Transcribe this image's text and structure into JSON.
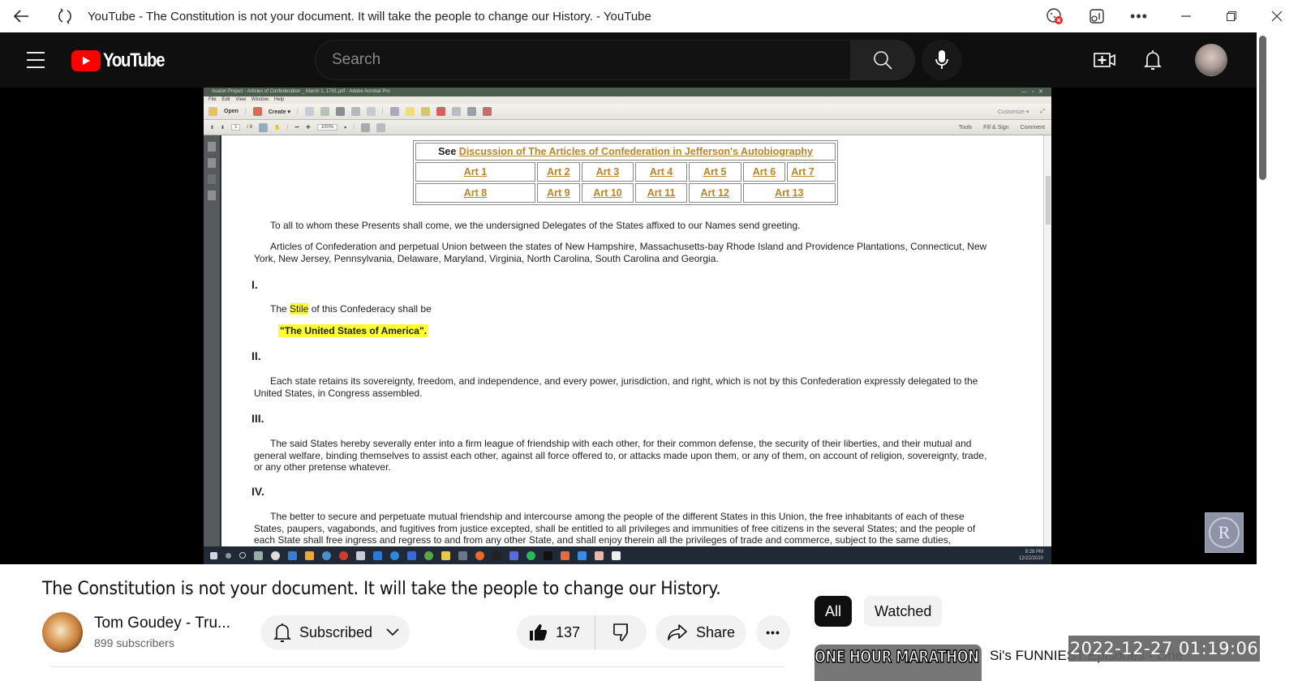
{
  "browser": {
    "tab_title": "YouTube - The Constitution is not your document. It will take the people to change our History. - YouTube",
    "icons": [
      "back-icon",
      "refresh-icon",
      "tracking-prevention-icon",
      "read-aloud-icon",
      "more-icon",
      "minimize-icon",
      "restore-icon",
      "close-icon"
    ]
  },
  "header": {
    "logo_text": "YouTube",
    "search_placeholder": "Search",
    "search_value": ""
  },
  "acrobat": {
    "window_title": "Avalon Project - Articles of Confederation _ March 1, 1781.pdf - Adobe Acrobat Pro",
    "menu": "File  Edit  View  Window  Help",
    "open_label": "Open",
    "create_label": "Create ▾",
    "customize_label": "Customize ▾",
    "page_num": "1",
    "page_total": "/ 8",
    "zoom": "100%",
    "right_tabs": [
      "Tools",
      "Fill & Sign",
      "Comment"
    ],
    "tray_time": "9:28 PM",
    "tray_date": "12/22/2020"
  },
  "document": {
    "see_label": "See",
    "discussion_link": "Discussion of The Articles of Confederation in Jefferson's Autobiography",
    "articles_row1": [
      "Art 1",
      "Art 2",
      "Art 3",
      "Art 4",
      "Art 5",
      "Art 6",
      "Art 7"
    ],
    "articles_row2": [
      "Art 8",
      "Art 9",
      "Art 10",
      "Art 11",
      "Art 12",
      "Art 13"
    ],
    "preamble": "To all to whom these Presents shall come, we the undersigned Delegates of the States affixed to our Names send greeting.",
    "intro": "Articles of Confederation and perpetual Union between the states of New Hampshire, Massachusetts-bay Rhode Island and Providence Plantations, Connecticut, New York, New Jersey, Pennsylvania, Delaware, Maryland, Virginia, North Carolina, South Carolina and Georgia.",
    "sections": [
      {
        "numeral": "I.",
        "text_before": "The ",
        "highlight": "Stile",
        "text_after": " of this Confederacy shall be",
        "quote": "\"The United States of America\"."
      },
      {
        "numeral": "II.",
        "text": "Each state retains its sovereignty, freedom, and independence, and every power, jurisdiction, and right, which is not by this Confederation expressly delegated to the United States, in Congress assembled."
      },
      {
        "numeral": "III.",
        "text": "The said States hereby severally enter into a firm league of friendship with each other, for their common defense, the security of their liberties, and their mutual and general welfare, binding themselves to assist each other, against all force offered to, or attacks made upon them, or any of them, on account of religion, sovereignty, trade, or any other pretense whatever."
      },
      {
        "numeral": "IV.",
        "text": "The better to secure and perpetuate mutual friendship and intercourse among the people of the different States in this Union, the free inhabitants of each of these States, paupers, vagabonds, and fugitives from justice excepted, shall be entitled to all privileges and immunities of free citizens in the several States; and the people of each State shall free ingress and regress to and from any other State, and shall enjoy therein all the privileges of trade and commerce, subject to the same duties,"
      }
    ]
  },
  "watermark": {
    "text": "R"
  },
  "video": {
    "title": "The Constitution is not your document. It will take the people to change our History.",
    "channel_name": "Tom Goudey - Tru...",
    "subscribers": "899 subscribers",
    "subscribed_label": "Subscribed",
    "likes": "137",
    "share_label": "Share",
    "more_label": "•••"
  },
  "sidebar": {
    "chips": [
      "All",
      "Watched"
    ],
    "active_chip": "All",
    "rec_thumb_text": "ONE HOUR MARATHON",
    "rec_title": "Si's FUNNIEST Episodes - One"
  },
  "overlay": {
    "timestamp": "2022-12-27 01:19:06"
  }
}
